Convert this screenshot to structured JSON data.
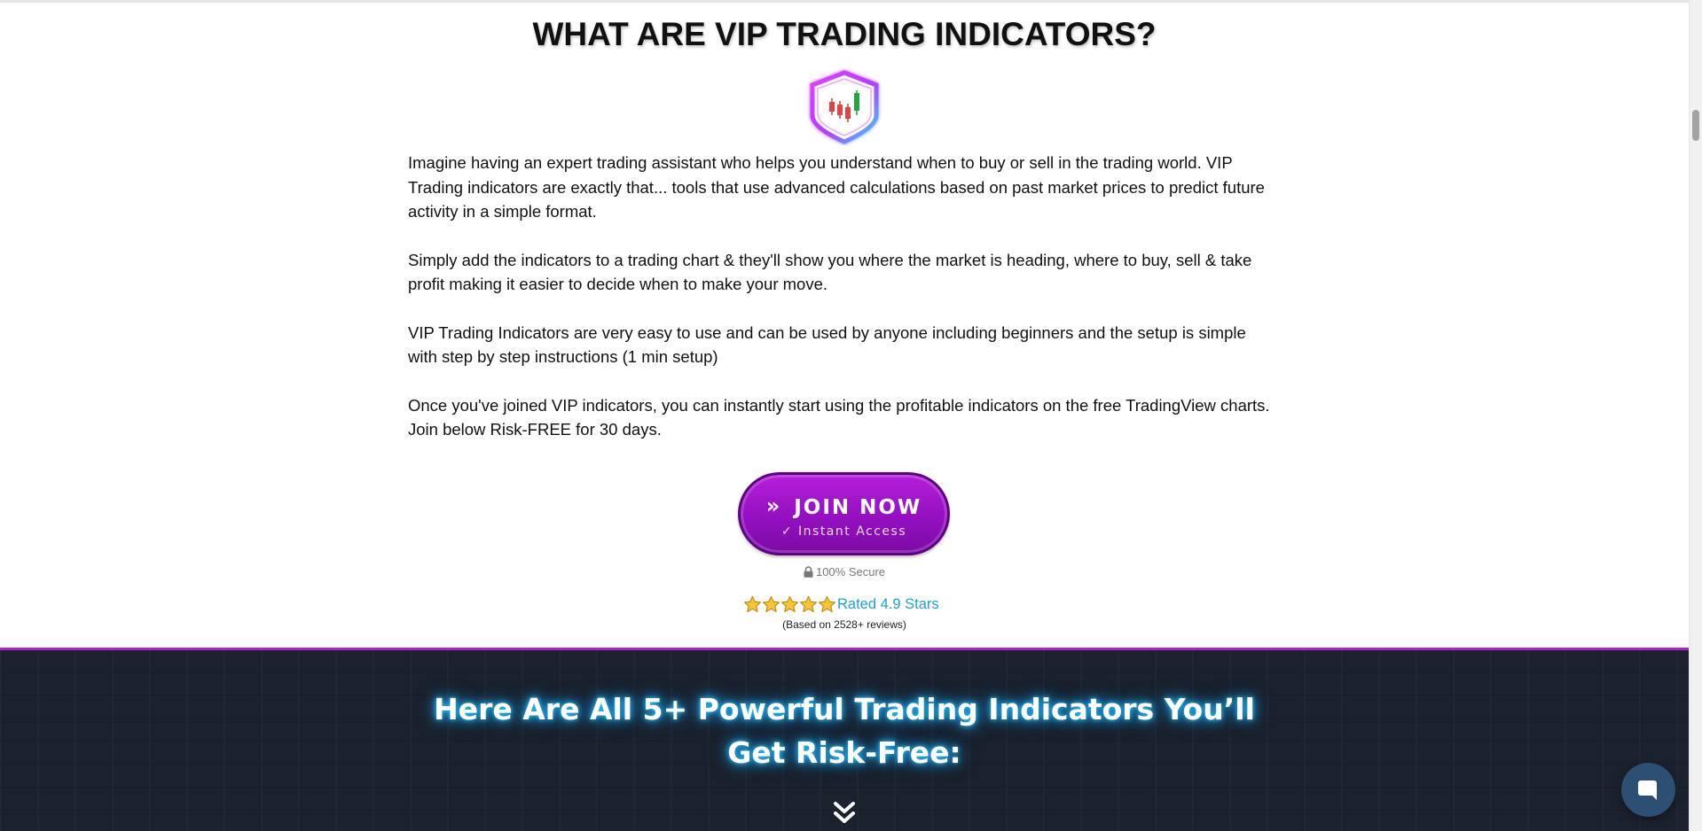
{
  "section": {
    "heading": "WHAT ARE VIP TRADING INDICATORS?",
    "badge_icon": "candlestick-shield-icon",
    "paragraphs": [
      "Imagine having an expert trading assistant who helps you understand when to buy or sell in the trading world. VIP Trading indicators are exactly that... tools that use advanced calculations based on past market prices to predict future activity in a simple format.",
      "Simply add the indicators to a trading chart & they'll show you where the market is heading, where to buy, sell & take profit making it easier to decide when to make your move.",
      "VIP Trading Indicators are very easy to use and can be used by anyone including beginners and the setup is simple with step by step instructions (1 min setup)",
      "Once you've joined VIP indicators, you can instantly start using the profitable indicators on the free TradingView charts. Join below Risk-FREE for 30 days."
    ]
  },
  "cta": {
    "arrow_icon": "double-chevron-right-icon",
    "label": "JOIN NOW",
    "sublabel": "✓ Instant Access",
    "color": "#9a13c6"
  },
  "trust": {
    "lock_icon": "lock-icon",
    "secure_text": "100% Secure",
    "star_icon": "star-icon",
    "star_count": 5,
    "rating_text": "Rated 4.9 Stars",
    "reviews_text": "(Based on 2528+ reviews)",
    "link_color": "#19a3dc"
  },
  "dark_section": {
    "heading": "Here Are All 5+ Powerful Trading Indicators You’ll Get Risk-Free:",
    "chevron_icon": "double-chevron-down-icon",
    "background": "#1b212d",
    "accent": "#b21ed8"
  },
  "chat": {
    "icon": "chat-bubble-icon"
  }
}
